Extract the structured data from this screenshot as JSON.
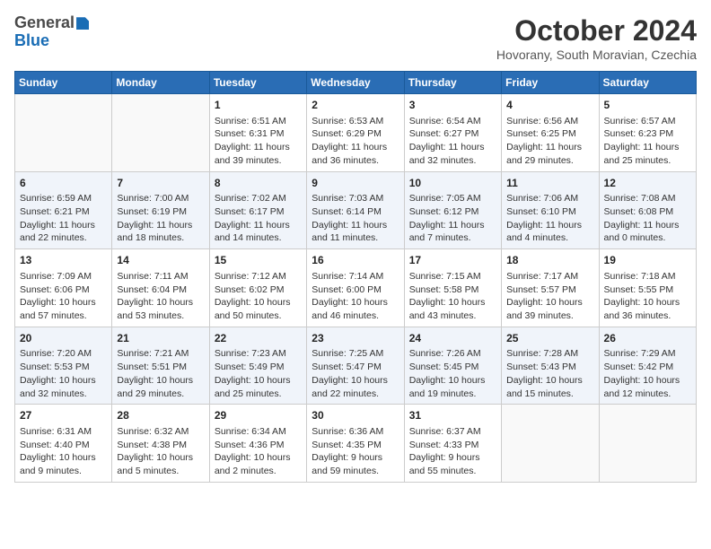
{
  "header": {
    "logo_general": "General",
    "logo_blue": "Blue",
    "month_title": "October 2024",
    "location": "Hovorany, South Moravian, Czechia"
  },
  "weekdays": [
    "Sunday",
    "Monday",
    "Tuesday",
    "Wednesday",
    "Thursday",
    "Friday",
    "Saturday"
  ],
  "weeks": [
    [
      {
        "day": "",
        "info": ""
      },
      {
        "day": "",
        "info": ""
      },
      {
        "day": "1",
        "info": "Sunrise: 6:51 AM\nSunset: 6:31 PM\nDaylight: 11 hours and 39 minutes."
      },
      {
        "day": "2",
        "info": "Sunrise: 6:53 AM\nSunset: 6:29 PM\nDaylight: 11 hours and 36 minutes."
      },
      {
        "day": "3",
        "info": "Sunrise: 6:54 AM\nSunset: 6:27 PM\nDaylight: 11 hours and 32 minutes."
      },
      {
        "day": "4",
        "info": "Sunrise: 6:56 AM\nSunset: 6:25 PM\nDaylight: 11 hours and 29 minutes."
      },
      {
        "day": "5",
        "info": "Sunrise: 6:57 AM\nSunset: 6:23 PM\nDaylight: 11 hours and 25 minutes."
      }
    ],
    [
      {
        "day": "6",
        "info": "Sunrise: 6:59 AM\nSunset: 6:21 PM\nDaylight: 11 hours and 22 minutes."
      },
      {
        "day": "7",
        "info": "Sunrise: 7:00 AM\nSunset: 6:19 PM\nDaylight: 11 hours and 18 minutes."
      },
      {
        "day": "8",
        "info": "Sunrise: 7:02 AM\nSunset: 6:17 PM\nDaylight: 11 hours and 14 minutes."
      },
      {
        "day": "9",
        "info": "Sunrise: 7:03 AM\nSunset: 6:14 PM\nDaylight: 11 hours and 11 minutes."
      },
      {
        "day": "10",
        "info": "Sunrise: 7:05 AM\nSunset: 6:12 PM\nDaylight: 11 hours and 7 minutes."
      },
      {
        "day": "11",
        "info": "Sunrise: 7:06 AM\nSunset: 6:10 PM\nDaylight: 11 hours and 4 minutes."
      },
      {
        "day": "12",
        "info": "Sunrise: 7:08 AM\nSunset: 6:08 PM\nDaylight: 11 hours and 0 minutes."
      }
    ],
    [
      {
        "day": "13",
        "info": "Sunrise: 7:09 AM\nSunset: 6:06 PM\nDaylight: 10 hours and 57 minutes."
      },
      {
        "day": "14",
        "info": "Sunrise: 7:11 AM\nSunset: 6:04 PM\nDaylight: 10 hours and 53 minutes."
      },
      {
        "day": "15",
        "info": "Sunrise: 7:12 AM\nSunset: 6:02 PM\nDaylight: 10 hours and 50 minutes."
      },
      {
        "day": "16",
        "info": "Sunrise: 7:14 AM\nSunset: 6:00 PM\nDaylight: 10 hours and 46 minutes."
      },
      {
        "day": "17",
        "info": "Sunrise: 7:15 AM\nSunset: 5:58 PM\nDaylight: 10 hours and 43 minutes."
      },
      {
        "day": "18",
        "info": "Sunrise: 7:17 AM\nSunset: 5:57 PM\nDaylight: 10 hours and 39 minutes."
      },
      {
        "day": "19",
        "info": "Sunrise: 7:18 AM\nSunset: 5:55 PM\nDaylight: 10 hours and 36 minutes."
      }
    ],
    [
      {
        "day": "20",
        "info": "Sunrise: 7:20 AM\nSunset: 5:53 PM\nDaylight: 10 hours and 32 minutes."
      },
      {
        "day": "21",
        "info": "Sunrise: 7:21 AM\nSunset: 5:51 PM\nDaylight: 10 hours and 29 minutes."
      },
      {
        "day": "22",
        "info": "Sunrise: 7:23 AM\nSunset: 5:49 PM\nDaylight: 10 hours and 25 minutes."
      },
      {
        "day": "23",
        "info": "Sunrise: 7:25 AM\nSunset: 5:47 PM\nDaylight: 10 hours and 22 minutes."
      },
      {
        "day": "24",
        "info": "Sunrise: 7:26 AM\nSunset: 5:45 PM\nDaylight: 10 hours and 19 minutes."
      },
      {
        "day": "25",
        "info": "Sunrise: 7:28 AM\nSunset: 5:43 PM\nDaylight: 10 hours and 15 minutes."
      },
      {
        "day": "26",
        "info": "Sunrise: 7:29 AM\nSunset: 5:42 PM\nDaylight: 10 hours and 12 minutes."
      }
    ],
    [
      {
        "day": "27",
        "info": "Sunrise: 6:31 AM\nSunset: 4:40 PM\nDaylight: 10 hours and 9 minutes."
      },
      {
        "day": "28",
        "info": "Sunrise: 6:32 AM\nSunset: 4:38 PM\nDaylight: 10 hours and 5 minutes."
      },
      {
        "day": "29",
        "info": "Sunrise: 6:34 AM\nSunset: 4:36 PM\nDaylight: 10 hours and 2 minutes."
      },
      {
        "day": "30",
        "info": "Sunrise: 6:36 AM\nSunset: 4:35 PM\nDaylight: 9 hours and 59 minutes."
      },
      {
        "day": "31",
        "info": "Sunrise: 6:37 AM\nSunset: 4:33 PM\nDaylight: 9 hours and 55 minutes."
      },
      {
        "day": "",
        "info": ""
      },
      {
        "day": "",
        "info": ""
      }
    ]
  ]
}
